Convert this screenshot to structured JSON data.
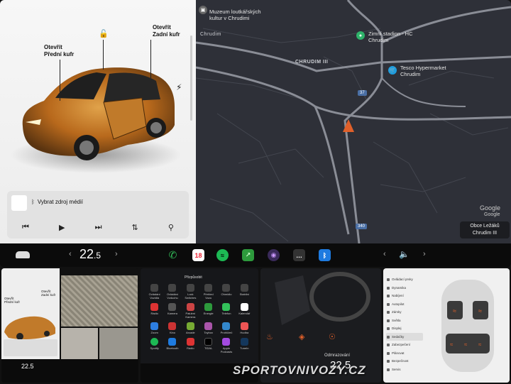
{
  "car": {
    "frunk_label_1": "Otevřít",
    "frunk_label_2": "Přední kufr",
    "trunk_label_1": "Otevřít",
    "trunk_label_2": "Zadní kufr"
  },
  "media": {
    "source_label": "Vybrat zdroj médií"
  },
  "map": {
    "poi_museum_1": "Muzeum loutkářských",
    "poi_museum_2": "kultur v Chrudimi",
    "poi_stadium_1": "Zimní stadion - HC",
    "poi_stadium_2": "Chrudim",
    "poi_tesco_1": "Tesco Hypermarket",
    "poi_tesco_2": "Chrudim",
    "label_chrudim": "Chrudim",
    "label_chrudim3": "CHRUDIM III",
    "road_37": "37",
    "road_340": "340",
    "google_1": "Google",
    "google_2": "Google",
    "location_1": "Obce Ležáků",
    "location_2": "Chrudim III"
  },
  "taskbar": {
    "temp_main": "22",
    "temp_decimal": ".5",
    "calendar_day": "18"
  },
  "thumbs": {
    "t1_frunk": "Otevřít Přední kufr",
    "t1_trunk": "Otevřít Zadní kufr",
    "t1_temp": "22.5",
    "t2_title": "Přizpůsobit",
    "t2_apps": [
      "Ovládání Vozidla",
      "Ovládání Vzduchu",
      "Lock Switches",
      "Přehled Vozu",
      "Ohmidlo",
      "Stabilní",
      "Rádio",
      "Kamera",
      "Palubní Kamera",
      "Energie",
      "Telefon",
      "Kalendář",
      "Zoom",
      "Kino",
      "Arcade",
      "Toybox",
      "Prohlížeč",
      "Hudba",
      "Spotify",
      "Bluetooth",
      "Rádio",
      "TIDAL",
      "Apple Podcasts",
      "TuneIn"
    ],
    "t3_label": "Odmrazování",
    "t3_temp": "22.5",
    "t4_menu": [
      "Ovládací prvky",
      "Dynamika",
      "Nabíjení",
      "Autopilot",
      "Zámky",
      "Světla",
      "Displej",
      "Sedačky",
      "Zabezpečení",
      "Plánovat",
      "Bezpečnost",
      "Servis"
    ]
  },
  "watermark": "SPORTOVNIVOZY.CZ"
}
